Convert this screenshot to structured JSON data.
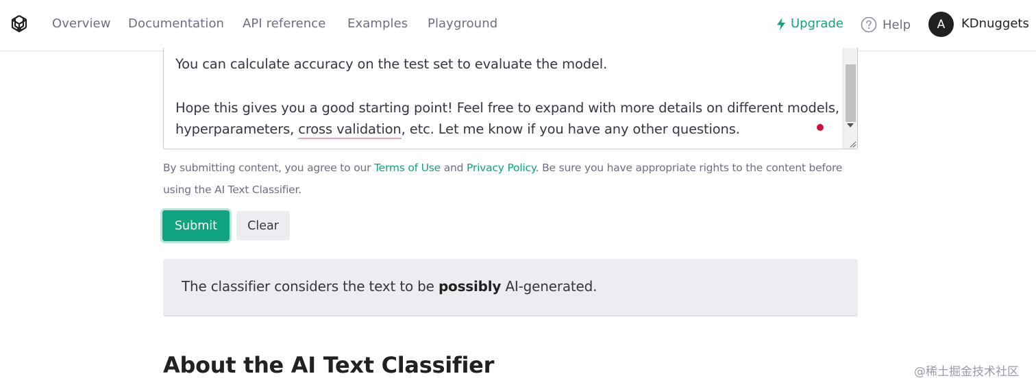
{
  "nav": {
    "links": [
      "Overview",
      "Documentation",
      "API reference",
      "Examples",
      "Playground"
    ],
    "upgrade": "Upgrade",
    "help": "Help",
    "avatar_initial": "A",
    "username": "KDnuggets"
  },
  "textarea": {
    "line1": "You can calculate accuracy on the test set to evaluate the model.",
    "line2": "Hope this gives you a good starting point! Feel free to expand with more details on different models,",
    "line3_before": "hyperparameters, ",
    "line3_misspelled": "cross validation",
    "line3_after": ", etc. Let me know if you have any other questions."
  },
  "disclaimer": {
    "text1": "By submitting content, you agree to our ",
    "terms": "Terms of Use",
    "text2": " and ",
    "privacy": "Privacy Policy",
    "text3": ". Be sure you have appropriate rights to the content before using the AI Text Classifier."
  },
  "buttons": {
    "submit": "Submit",
    "clear": "Clear"
  },
  "result": {
    "prefix": "The classifier considers the text to be ",
    "verdict": "possibly",
    "suffix": " AI-generated."
  },
  "about_heading": "About the AI Text Classifier",
  "watermark": "@稀土掘金技术社区",
  "colors": {
    "accent": "#10a37f",
    "result_bg": "#ececf1",
    "spellcheck_underline": "#f0a3b8"
  }
}
